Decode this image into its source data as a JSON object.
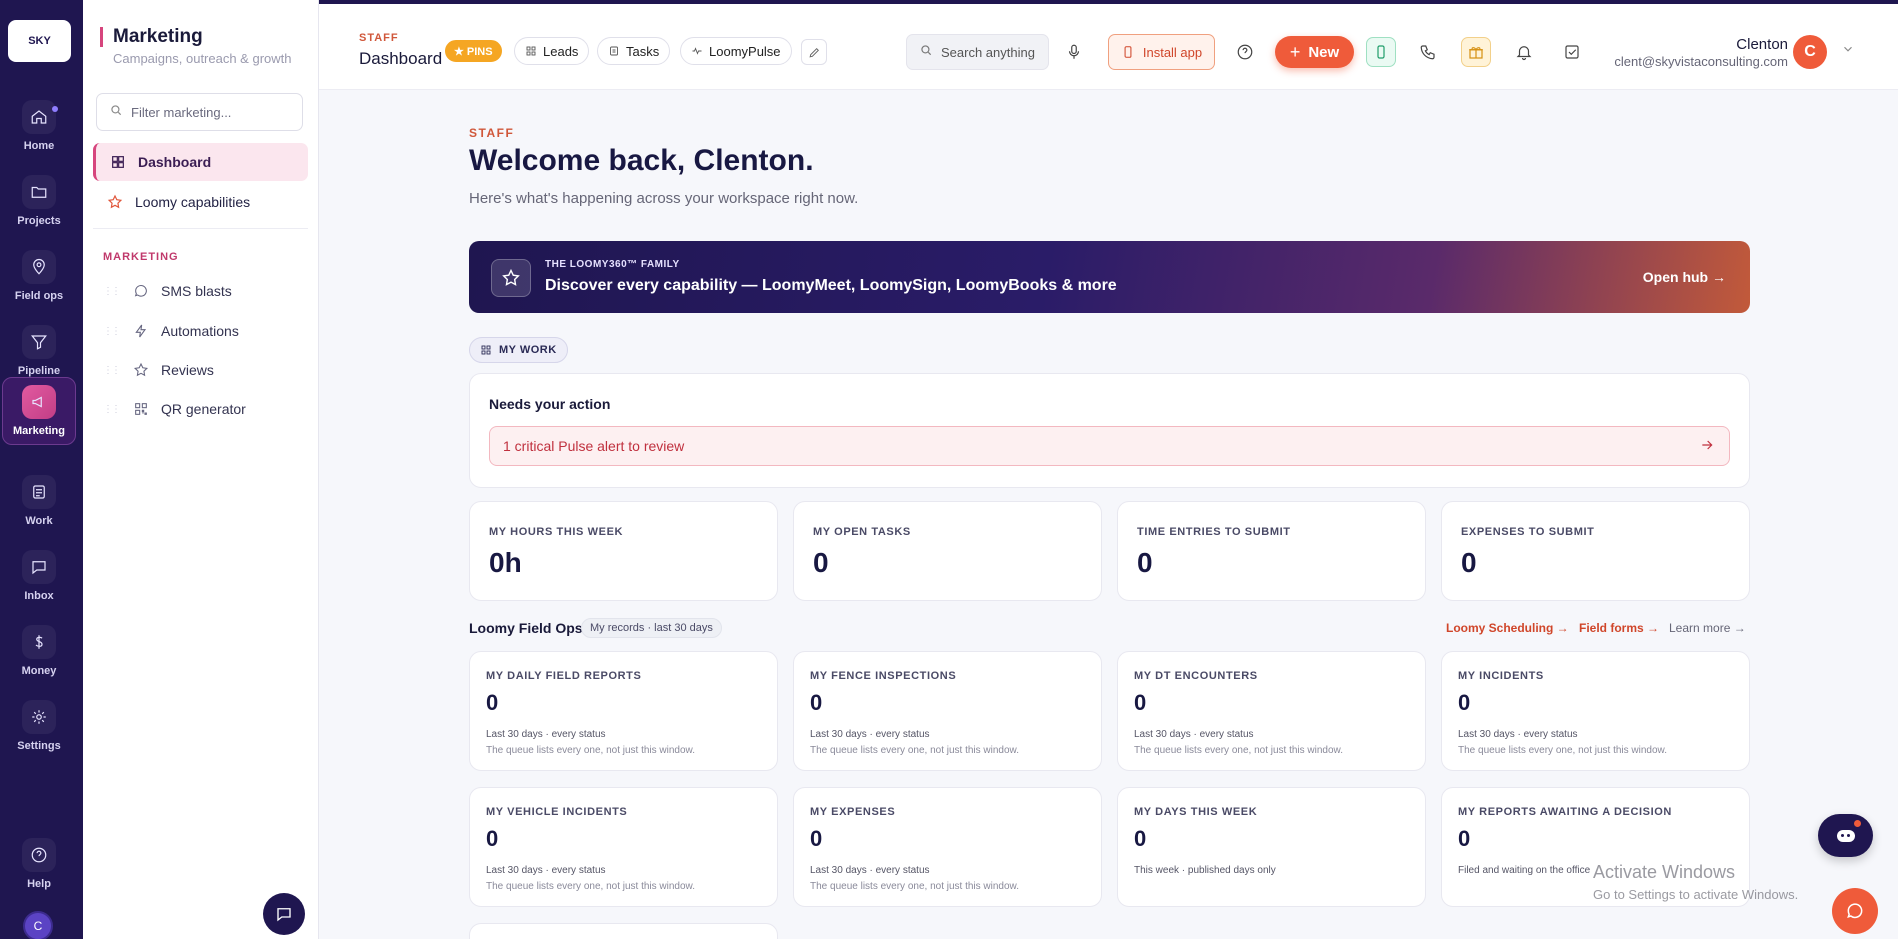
{
  "rail": {
    "logo": "SKY",
    "items": [
      {
        "label": "Home",
        "icon": "home-icon"
      },
      {
        "label": "Projects",
        "icon": "folder-icon"
      },
      {
        "label": "Field ops",
        "icon": "map-pin-icon"
      },
      {
        "label": "Pipeline",
        "icon": "filter-icon"
      },
      {
        "label": "Marketing",
        "icon": "megaphone-icon"
      },
      {
        "label": "Work",
        "icon": "list-icon"
      },
      {
        "label": "Inbox",
        "icon": "message-icon"
      },
      {
        "label": "Money",
        "icon": "dollar-icon"
      },
      {
        "label": "Settings",
        "icon": "gear-icon"
      },
      {
        "label": "Help",
        "icon": "help-icon"
      }
    ],
    "avatar": "C"
  },
  "sidebar": {
    "title": "Marketing",
    "subtitle": "Campaigns, outreach & growth",
    "filter_placeholder": "Filter marketing...",
    "links": [
      {
        "label": "Dashboard"
      },
      {
        "label": "Loomy capabilities"
      }
    ],
    "section": "MARKETING",
    "items": [
      {
        "label": "SMS blasts"
      },
      {
        "label": "Automations"
      },
      {
        "label": "Reviews"
      },
      {
        "label": "QR generator"
      }
    ]
  },
  "topbar": {
    "tag": "STAFF",
    "title": "Dashboard",
    "pins": "★ PINS",
    "pills": [
      "Leads",
      "Tasks",
      "LoomyPulse"
    ],
    "search_placeholder": "Search anything",
    "install": "Install app",
    "new": "New",
    "user_name": "Clenton",
    "user_email": "clent@skyvistaconsulting.com",
    "avatar": "C"
  },
  "main": {
    "tag": "STAFF",
    "title": "Welcome back, Clenton.",
    "subtitle": "Here's what's happening across your workspace right now.",
    "banner": {
      "kicker": "THE LOOMY360™ FAMILY",
      "text": "Discover every capability — LoomyMeet, LoomySign, LoomyBooks & more",
      "cta": "Open hub →"
    },
    "mywork": "MY WORK",
    "action": {
      "title": "Needs your action",
      "alert": "1 critical Pulse alert to review"
    },
    "stats": [
      {
        "label": "MY HOURS THIS WEEK",
        "value": "0h"
      },
      {
        "label": "MY OPEN TASKS",
        "value": "0"
      },
      {
        "label": "TIME ENTRIES TO SUBMIT",
        "value": "0"
      },
      {
        "label": "EXPENSES TO SUBMIT",
        "value": "0"
      }
    ],
    "fieldops": {
      "title": "Loomy Field Ops",
      "badge": "My records · last 30 days",
      "links": [
        "Loomy Scheduling →",
        "Field forms →",
        "Learn more →"
      ],
      "cards": [
        {
          "label": "MY DAILY FIELD REPORTS",
          "value": "0",
          "l1": "Last 30 days · every status",
          "l2": "The queue lists every one, not just this window."
        },
        {
          "label": "MY FENCE INSPECTIONS",
          "value": "0",
          "l1": "Last 30 days · every status",
          "l2": "The queue lists every one, not just this window."
        },
        {
          "label": "MY DT ENCOUNTERS",
          "value": "0",
          "l1": "Last 30 days · every status",
          "l2": "The queue lists every one, not just this window."
        },
        {
          "label": "MY INCIDENTS",
          "value": "0",
          "l1": "Last 30 days · every status",
          "l2": "The queue lists every one, not just this window."
        },
        {
          "label": "MY VEHICLE INCIDENTS",
          "value": "0",
          "l1": "Last 30 days · every status",
          "l2": "The queue lists every one, not just this window."
        },
        {
          "label": "MY EXPENSES",
          "value": "0",
          "l1": "Last 30 days · every status",
          "l2": "The queue lists every one, not just this window."
        },
        {
          "label": "MY DAYS THIS WEEK",
          "value": "0",
          "l1": "This week · published days only",
          "l2": ""
        },
        {
          "label": "MY REPORTS AWAITING A DECISION",
          "value": "0",
          "l1": "Filed and waiting on the office",
          "l2": ""
        }
      ]
    }
  },
  "watermark": {
    "line1": "Activate Windows",
    "line2": "Go to Settings to activate Windows."
  }
}
